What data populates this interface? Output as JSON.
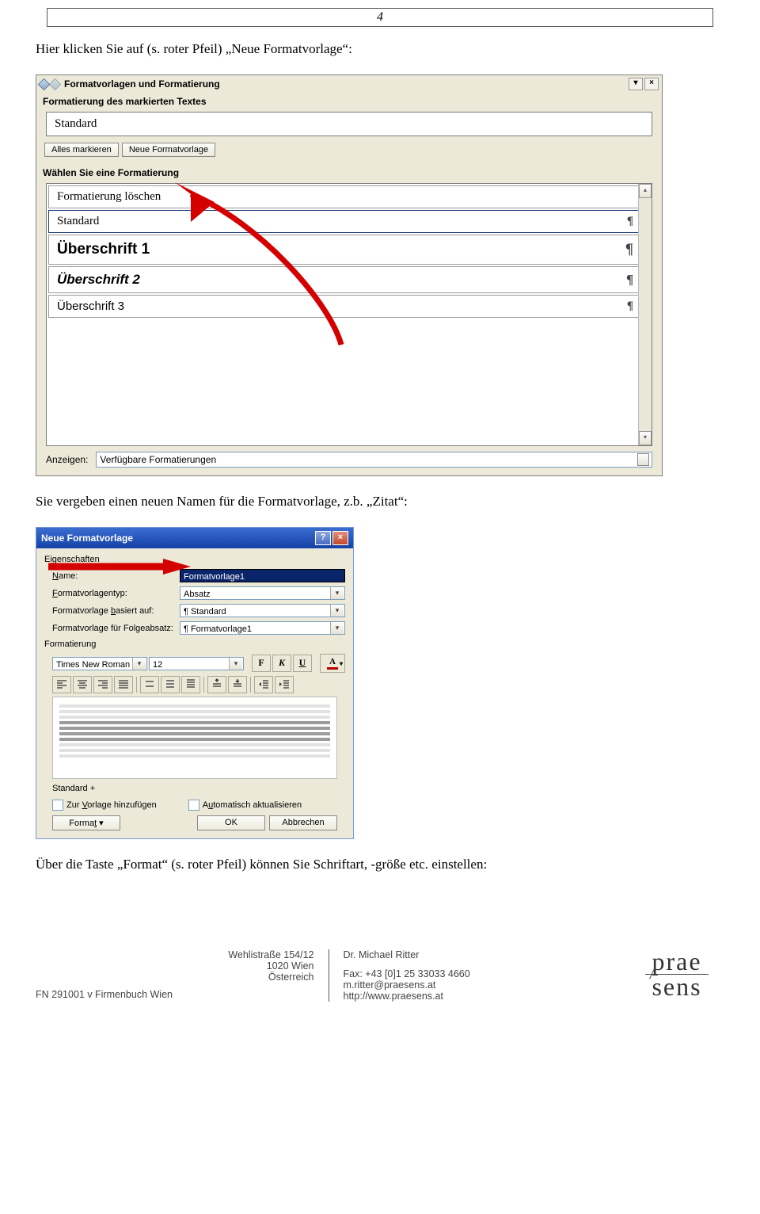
{
  "page_number": "4",
  "para1": "Hier klicken Sie auf (s. roter Pfeil) „Neue Formatvorlage“:",
  "para2": "Sie vergeben einen neuen Namen für die Formatvorlage, z.b. „Zitat“:",
  "para3": "Über die Taste „Format“ (s. roter Pfeil) können Sie Schriftart, -größe etc. einstellen:",
  "shot1": {
    "title": "Formatvorlagen und Formatierung",
    "section1": "Formatierung des markierten Textes",
    "current_style": "Standard",
    "btn_select_all": "Alles markieren",
    "btn_new_style": "Neue Formatvorlage",
    "section2": "Wählen Sie eine Formatierung",
    "item1": "Formatierung löschen",
    "item2": "Standard",
    "item3": "Überschrift 1",
    "item4": "Überschrift 2",
    "item5": "Überschrift 3",
    "anzeigen_lbl": "Anzeigen:",
    "anzeigen_val": "Verfügbare Formatierungen"
  },
  "shot2": {
    "title": "Neue Formatvorlage",
    "grp_props": "Eigenschaften",
    "lbl_name": "Name:",
    "val_name": "Formatvorlage1",
    "lbl_type": "Formatvorlagentyp:",
    "val_type": "Absatz",
    "lbl_based": "Formatvorlage basiert auf:",
    "val_based": "¶ Standard",
    "lbl_next": "Formatvorlage für Folgeabsatz:",
    "val_next": "¶ Formatvorlage1",
    "grp_fmt": "Formatierung",
    "font_name": "Times New Roman",
    "font_size": "12",
    "based_on": "Standard +",
    "chk_add": "Zur Vorlage hinzufügen",
    "chk_auto": "Automatisch aktualisieren",
    "btn_format": "Format ▾",
    "btn_ok": "OK",
    "btn_cancel": "Abbrechen"
  },
  "footer": {
    "addr1": "Wehlistraße 154/12",
    "addr2": "1020 Wien",
    "addr3": "Österreich",
    "fn": "FN 291001 v   Firmenbuch Wien",
    "name": "Dr. Michael Ritter",
    "fax": "Fax: +43 [0]1 25 33033 4660",
    "email": "m.ritter@praesens.at",
    "web": "http://www.praesens.at",
    "logo1": "prae",
    "logo2": "sens"
  }
}
